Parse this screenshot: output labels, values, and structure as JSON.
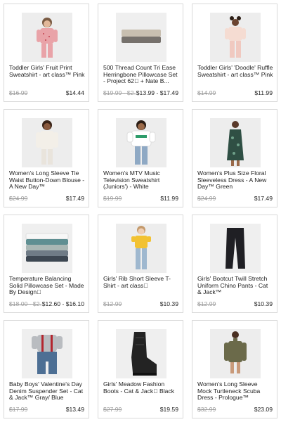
{
  "products": [
    {
      "title": "Toddler Girls' Fruit Print Sweatshirt - art class™ Pink",
      "original_price": "$16.99",
      "price": "$14.44",
      "image": "girl-pink-sweatshirt"
    },
    {
      "title": "500 Thread Count Tri Ease Herringbone Pillowcase Set - Project 62\u0000 + Nate B...",
      "original_price": "$19.99 - $2…",
      "price": "$13.99 - $17.49",
      "image": "folded-pillowcases"
    },
    {
      "title": "Toddler Girls' 'Doodle' Ruffle Sweatshirt - art class™ Pink",
      "original_price": "$14.99",
      "price": "$11.99",
      "image": "girl-doodle-sweatshirt"
    },
    {
      "title": "Women's Long Sleeve Tie Waist Button-Down Blouse - A New Day™",
      "original_price": "$24.99",
      "price": "$17.49",
      "image": "woman-white-blouse"
    },
    {
      "title": "Women's MTV Music Television Sweatshirt (Juniors') - White",
      "original_price": "$19.99",
      "price": "$11.99",
      "image": "woman-mtv-sweatshirt"
    },
    {
      "title": "Women's Plus Size Floral Sleeveless Dress - A New Day™ Green",
      "original_price": "$24.99",
      "price": "$17.49",
      "image": "woman-green-dress"
    },
    {
      "title": "Temperature Balancing Solid Pillowcase Set - Made By Design\u0000",
      "original_price": "$18.00 - $2…",
      "price": "$12.60 - $16.10",
      "image": "stacked-pillowcases"
    },
    {
      "title": "Girls' Rib Short Sleeve T-Shirt - art class\u0000",
      "original_price": "$12.99",
      "price": "$10.39",
      "image": "girl-yellow-tshirt"
    },
    {
      "title": "Girls' Bootcut Twill Stretch Uniform Chino Pants - Cat & Jack™",
      "original_price": "$12.99",
      "price": "$10.39",
      "image": "girl-black-pants"
    },
    {
      "title": "Baby Boys' Valentine's Day Denim Suspender Set - Cat & Jack™ Gray/ Blue",
      "original_price": "$17.99",
      "price": "$13.49",
      "image": "baby-suspender-set"
    },
    {
      "title": "Girls' Meadow Fashion Boots - Cat & Jack\u0000 Black",
      "original_price": "$27.99",
      "price": "$19.59",
      "image": "black-cowboy-boot"
    },
    {
      "title": "Women's Long Sleeve Mock Turtleneck Scuba Dress - Prologue™",
      "original_price": "$32.99",
      "price": "$23.09",
      "image": "woman-olive-dress"
    }
  ],
  "colors": {
    "card_border": "#d9d9d9",
    "original_price": "#9a9a9a",
    "text": "#222222",
    "thumb_bg": "#eeeeee"
  }
}
